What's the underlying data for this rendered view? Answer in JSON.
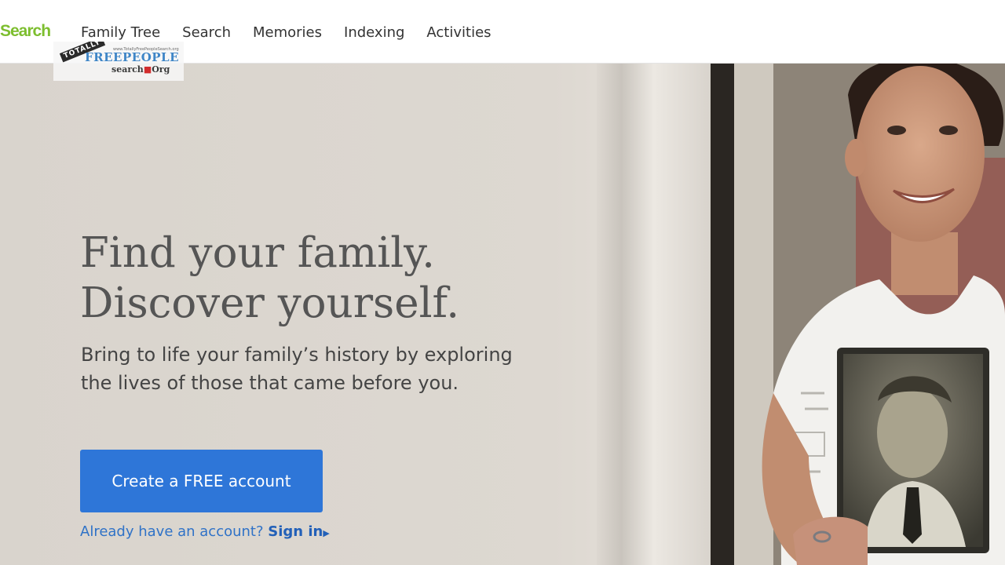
{
  "brand": {
    "label": "Search",
    "color": "#7dbe2f"
  },
  "nav": {
    "items": [
      {
        "label": "Family Tree"
      },
      {
        "label": "Search"
      },
      {
        "label": "Memories"
      },
      {
        "label": "Indexing"
      },
      {
        "label": "Activities"
      }
    ]
  },
  "watermark": {
    "badge": "TOTALLY",
    "url": "www.TotallyFreePeopleSearch.org",
    "name": "FREEPEOPLE",
    "sub": "search",
    "sub_suffix": "Org"
  },
  "hero": {
    "headline_line1": "Find your family.",
    "headline_line2": "Discover yourself.",
    "subhead": "Bring to life your family’s history by exploring the lives of those that came before you.",
    "cta_label": "Create a FREE account",
    "signin_prompt": "Already have an account?",
    "signin_label": "Sign in",
    "cta_color": "#2e76d8"
  }
}
